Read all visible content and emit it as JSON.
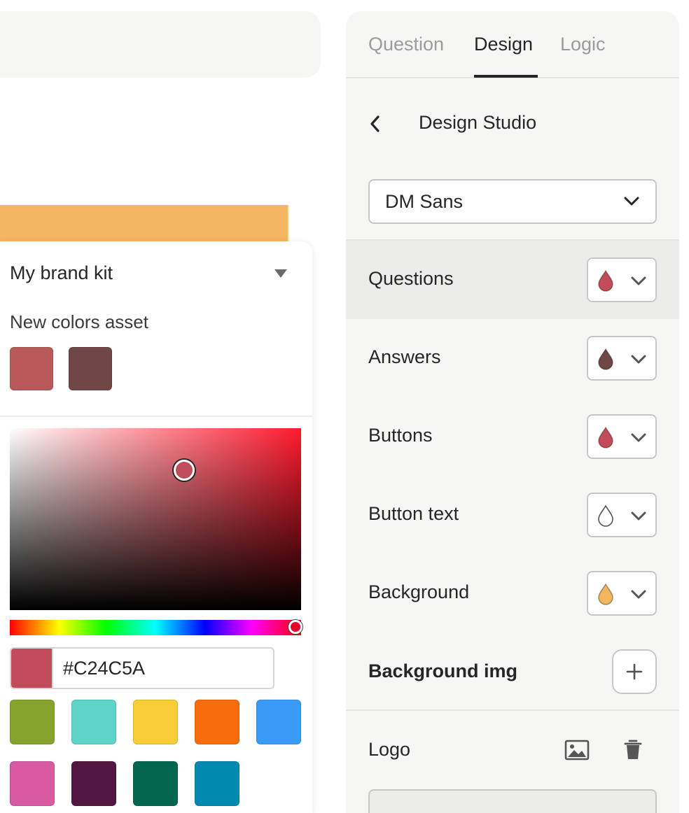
{
  "popover": {
    "kit_title": "My brand kit",
    "asset_title": "New colors asset",
    "brand_colors": [
      "#b85a5a",
      "#704646"
    ],
    "hue_color": "#ff1a2e",
    "hex_value": "#C24C5A",
    "preview_color": "#c24c5a",
    "presets": [
      "#86a32e",
      "#5fd4c8",
      "#f8cd35",
      "#f86c0c",
      "#3a9af8",
      "#d85aa0",
      "#511641",
      "#03664f",
      "#0189b1"
    ]
  },
  "canvas": {
    "accent_color": "#f3b661"
  },
  "panel": {
    "tabs": [
      {
        "label": "Question",
        "active": false
      },
      {
        "label": "Design",
        "active": true
      },
      {
        "label": "Logic",
        "active": false
      }
    ],
    "studio_title": "Design Studio",
    "font_value": "DM Sans",
    "color_rows": [
      {
        "label": "Questions",
        "color": "#c24c5a",
        "active": true
      },
      {
        "label": "Answers",
        "color": "#704646",
        "active": false
      },
      {
        "label": "Buttons",
        "color": "#c24c5a",
        "active": false
      },
      {
        "label": "Button text",
        "color": "#ffffff",
        "active": false
      },
      {
        "label": "Background",
        "color": "#f3b661",
        "active": false
      }
    ],
    "background_img_label": "Background img",
    "logo_label": "Logo",
    "icons": {
      "back": "chevron-left-icon",
      "dropdown": "chevron-down-icon",
      "drop": "color-drop-icon",
      "add": "plus-icon",
      "image": "image-icon",
      "delete": "trash-icon"
    }
  }
}
